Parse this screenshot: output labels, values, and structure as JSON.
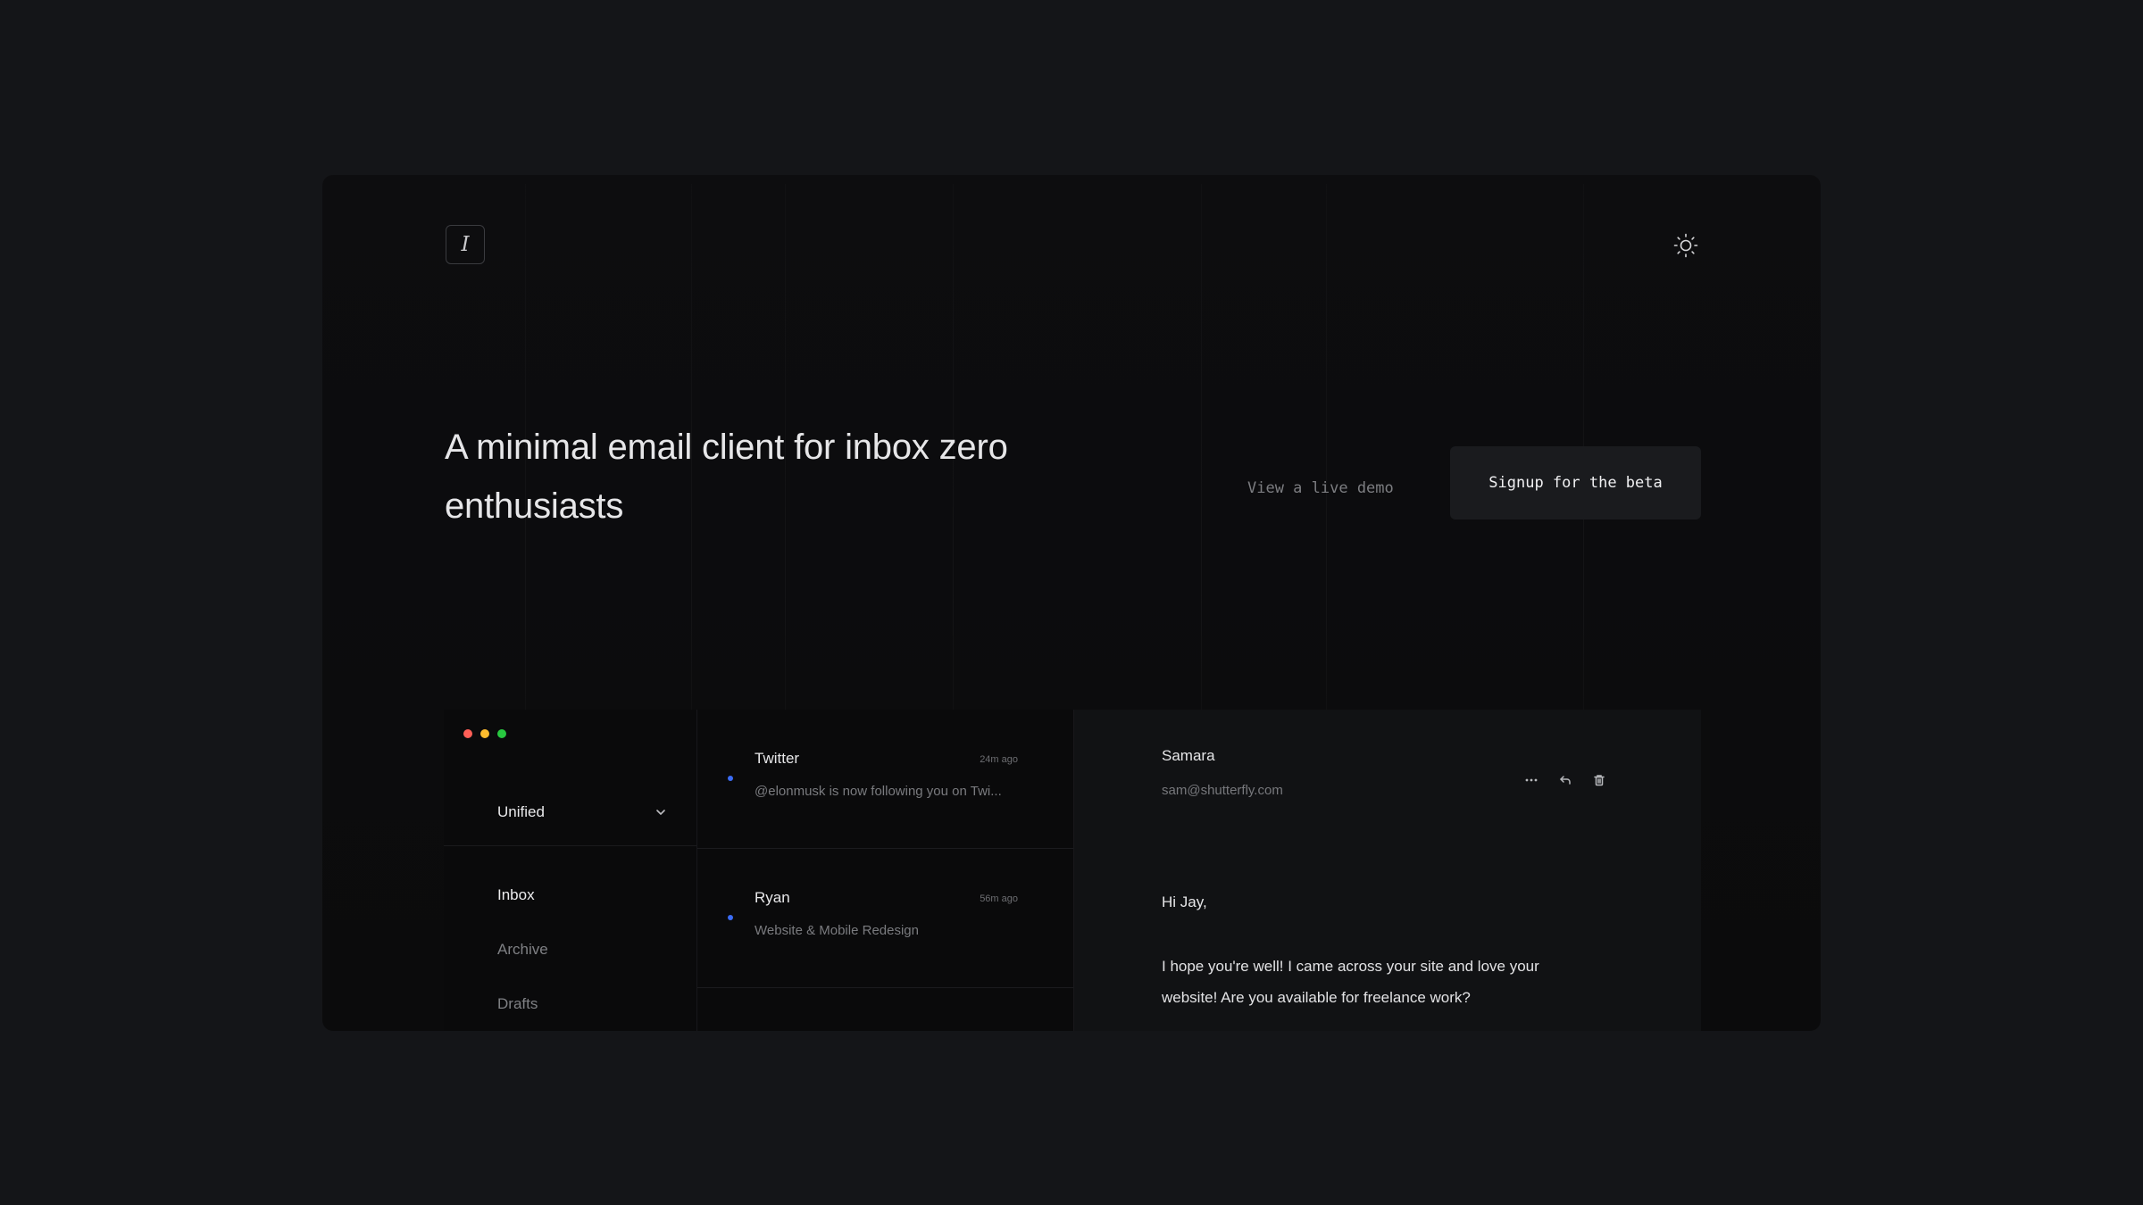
{
  "brand": {
    "logo_letter": "I"
  },
  "header": {
    "theme_icon": "sun-icon"
  },
  "hero": {
    "title": "A minimal email client for inbox zero enthusiasts",
    "demo_link": "View a live demo",
    "cta_button": "Signup for the beta"
  },
  "app": {
    "window_dots": [
      "#ff5f57",
      "#febc2e",
      "#28c840"
    ],
    "account_select": {
      "value": "Unified",
      "icon": "chevron-down-icon"
    },
    "nav": [
      {
        "label": "Inbox",
        "active": true
      },
      {
        "label": "Archive",
        "active": false
      },
      {
        "label": "Drafts",
        "active": false
      }
    ],
    "messages": [
      {
        "sender": "Twitter",
        "time": "24m ago",
        "preview": "@elonmusk is now following you on Twi...",
        "unread": true
      },
      {
        "sender": "Ryan",
        "time": "56m ago",
        "preview": "Website & Mobile Redesign",
        "unread": true
      }
    ],
    "reader": {
      "from_name": "Samara",
      "from_email": "sam@shutterfly.com",
      "actions": [
        "more-icon",
        "reply-icon",
        "trash-icon"
      ],
      "greeting": "Hi Jay,",
      "body": "I hope you're well! I came across your site and love your website! Are you available for freelance work?"
    }
  },
  "colors": {
    "accent_unread": "#3b6cf5",
    "page_bg": "#141518",
    "frame_bg": "#0c0c0e"
  }
}
